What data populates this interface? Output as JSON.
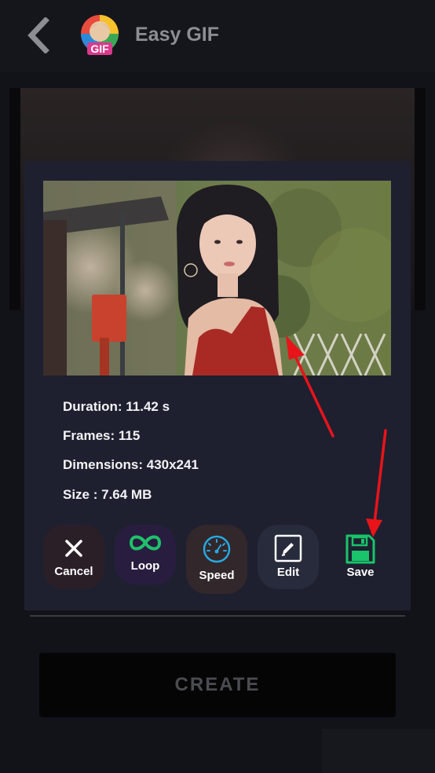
{
  "app": {
    "title": "Easy GIF",
    "logo_text": "GIF"
  },
  "gif_info": {
    "duration": "Duration: 11.42 s",
    "frames": "Frames: 115",
    "dimensions": "Dimensions: 430x241",
    "size": "Size : 7.64 MB"
  },
  "actions": [
    {
      "label": "Cancel",
      "icon": "close-icon",
      "color": "#ffffff",
      "background": "#2b1f27"
    },
    {
      "label": "Loop",
      "icon": "infinity-icon",
      "color": "#1fc16b",
      "background": "#291d3f"
    },
    {
      "label": "Speed",
      "icon": "speedometer-icon",
      "color": "#27a8e0",
      "background": "#32272a"
    },
    {
      "label": "Edit",
      "icon": "pencil-icon",
      "color": "#ffffff",
      "background": "#272b3b"
    },
    {
      "label": "Save",
      "icon": "floppy-disk-icon",
      "color": "#19c46a",
      "background": "#1e2030"
    }
  ],
  "create_button": {
    "label": "CREATE"
  },
  "annotation": {
    "arrow_color": "#e8141a"
  }
}
